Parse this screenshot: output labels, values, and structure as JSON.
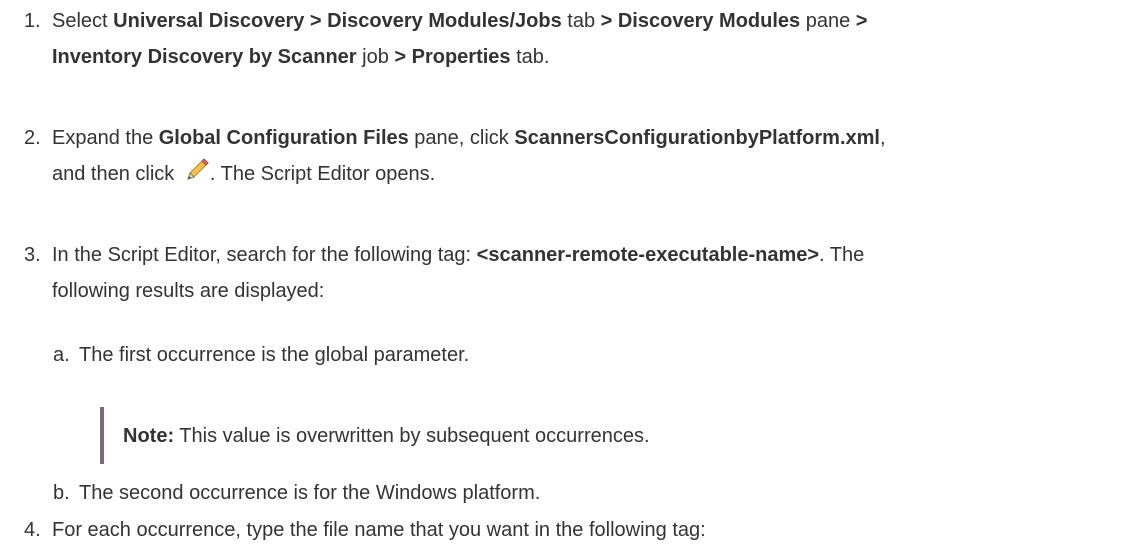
{
  "steps": [
    {
      "number": "1.",
      "parts": {
        "p1": "Select ",
        "b1": "Universal Discovery > Discovery Modules/Jobs",
        "p2": " tab ",
        "b2": "> Discovery Modules",
        "p3": " pane ",
        "b3": ">",
        "b4": "Inventory Discovery by Scanner",
        "p4": " job ",
        "b5": " > Properties",
        "p5": " tab."
      }
    },
    {
      "number": "2.",
      "parts": {
        "p1": "Expand the ",
        "b1": "Global Configuration Files",
        "p2": " pane, click ",
        "b2": "ScannersConfigurationbyPlatform.xml",
        "p3": ",",
        "p4": "and then click ",
        "p5": ". The Script Editor opens."
      }
    },
    {
      "number": "3.",
      "parts": {
        "p1": "In the Script Editor, search for the following tag: ",
        "b1": "<scanner-remote-executable-name>",
        "p2": ". The",
        "p3": "following results are displayed:"
      }
    },
    {
      "number": "4.",
      "parts": {
        "p1": "For each occurrence, type the file name that you want in the following tag:"
      }
    }
  ],
  "substeps": [
    {
      "letter": "a.",
      "text": "The first occurrence is the global parameter."
    },
    {
      "letter": "b.",
      "text": "The second occurrence is for the Windows platform."
    }
  ],
  "note": {
    "label": "Note:",
    "text": " This value is overwritten by subsequent occurrences."
  },
  "icons": {
    "edit": "pencil-edit-icon"
  }
}
